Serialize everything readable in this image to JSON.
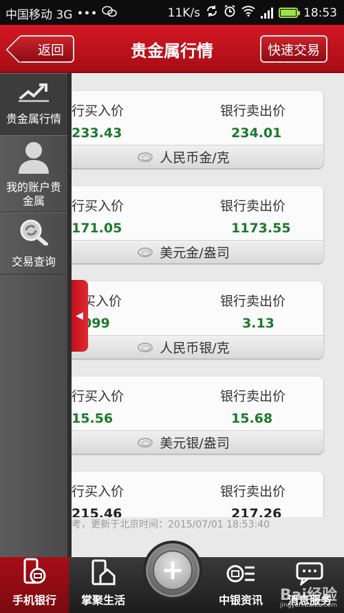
{
  "status": {
    "carrier": "中国移动 3G",
    "dots": "•••",
    "speed": "11K/s",
    "time": "18:53"
  },
  "header": {
    "back_label": "返回",
    "title": "贵金属行情",
    "quick_trade_label": "快速交易"
  },
  "drawer": {
    "items": [
      {
        "label": "贵金属行情",
        "icon": "trend-chart-icon"
      },
      {
        "label": "我的账户贵金属",
        "icon": "user-icon"
      },
      {
        "label": "交易查询",
        "icon": "search-icon"
      }
    ],
    "handle_glyph": "◀"
  },
  "cards": [
    {
      "buy_label": "行买入价",
      "sell_label": "银行卖出价",
      "buy": "233.43",
      "sell": "234.01",
      "unit": "人民币金/克"
    },
    {
      "buy_label": "行买入价",
      "sell_label": "银行卖出价",
      "buy": "171.05",
      "sell": "1173.55",
      "unit": "美元金/盎司"
    },
    {
      "buy_label": "买入价",
      "sell_label": "银行卖出价",
      "buy": "099",
      "sell": "3.13",
      "unit": "人民币银/克"
    },
    {
      "buy_label": "行买入价",
      "sell_label": "银行卖出价",
      "buy": "15.56",
      "sell": "15.68",
      "unit": "美元银/盎司"
    },
    {
      "buy_label": "行买入价",
      "sell_label": "银行卖出价",
      "buy": "215.46",
      "sell": "217.26",
      "unit": ""
    }
  ],
  "footnote": "考，更新于北京时间：2015/07/01 18:53:40",
  "bottomnav": {
    "items": [
      {
        "label": "手机银行",
        "icon": "mobile-bank-icon"
      },
      {
        "label": "掌聚生活",
        "icon": "house-icon"
      },
      {
        "label": "中银资讯",
        "icon": "news-icon"
      },
      {
        "label": "消息服务",
        "icon": "message-icon"
      }
    ],
    "center_glyph": "+"
  },
  "watermark": {
    "brand": "Bai经验",
    "sub": "jingyan.baidu.com"
  },
  "colors": {
    "brand_red": "#c8121c",
    "value_green": "#1a7a2a"
  }
}
